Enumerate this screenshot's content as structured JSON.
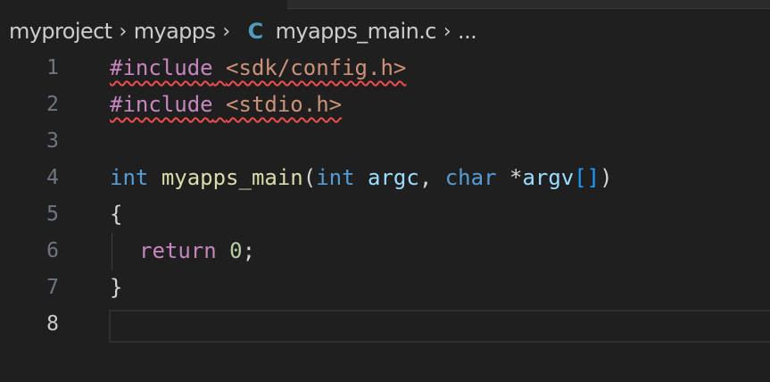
{
  "breadcrumb": {
    "items": [
      "myproject",
      "myapps",
      "myapps_main.c",
      "..."
    ],
    "separator": "›",
    "file_icon": "C"
  },
  "editor": {
    "line_numbers": [
      "1",
      "2",
      "3",
      "4",
      "5",
      "6",
      "7",
      "8"
    ],
    "current_line": "8",
    "lines": [
      {
        "tokens": [
          "#include",
          " ",
          "<sdk/config.h>"
        ]
      },
      {
        "tokens": [
          "#include",
          " ",
          "<stdio.h>"
        ]
      },
      {
        "tokens": []
      },
      {
        "tokens": [
          "int",
          " ",
          "myapps_main",
          "(",
          "int",
          " ",
          "argc",
          ", ",
          "char",
          " *",
          "argv",
          "[]",
          ")"
        ]
      },
      {
        "tokens": [
          "{"
        ]
      },
      {
        "tokens": [
          "return",
          " ",
          "0",
          ";"
        ]
      },
      {
        "tokens": [
          "}"
        ]
      },
      {
        "tokens": []
      }
    ]
  },
  "colors": {
    "background": "#1f1f1f",
    "keyword_control": "#c586c0",
    "keyword_type": "#569cd6",
    "function": "#dcdcaa",
    "parameter": "#9cdcfe",
    "string": "#ce9178",
    "number": "#b5cea8",
    "bracket": "#179fff",
    "error_squiggle": "#f14c4c",
    "c_file_icon": "#519aba"
  }
}
